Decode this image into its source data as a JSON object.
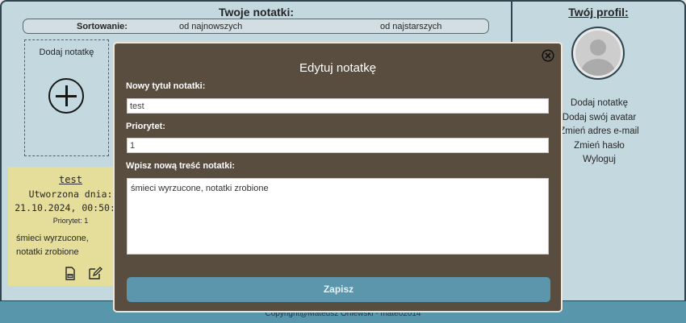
{
  "notes_panel": {
    "title": "Twoje notatki:",
    "sort": {
      "label": "Sortowanie:",
      "option_newest": "od najnowszych",
      "option_oldest": "od najstarszych"
    },
    "add_note_card": {
      "title": "Dodaj notatkę"
    },
    "note": {
      "title": "test",
      "created_label": "Utworzona dnia:",
      "created_date": "21.10.2024, 00:50:16",
      "priority": "Priorytet: 1",
      "content": "śmieci wyrzucone, notatki zrobione"
    }
  },
  "profile": {
    "title": "Twój profil:",
    "links": [
      "Dodaj notatkę",
      "Dodaj swój avatar",
      "Zmień adres e-mail",
      "Zmień hasło",
      "Wyloguj"
    ]
  },
  "footer": {
    "text": "Copyright@Mateusz Oniewski - mate02014"
  },
  "modal": {
    "title": "Edytuj notatkę",
    "title_label": "Nowy tytuł notatki:",
    "title_value": "test",
    "priority_label": "Priorytet:",
    "priority_value": "1",
    "content_label": "Wpisz nową treść notatki:",
    "content_value": "śmieci wyrzucone, notatki zrobione",
    "save_label": "Zapisz"
  },
  "colors": {
    "panel_bg": "#d5ecf5",
    "note_bg": "#fbf3a6",
    "modal_bg": "#584d3f",
    "save_button": "#5b96ac",
    "footer_bg": "#5aa1ba"
  }
}
